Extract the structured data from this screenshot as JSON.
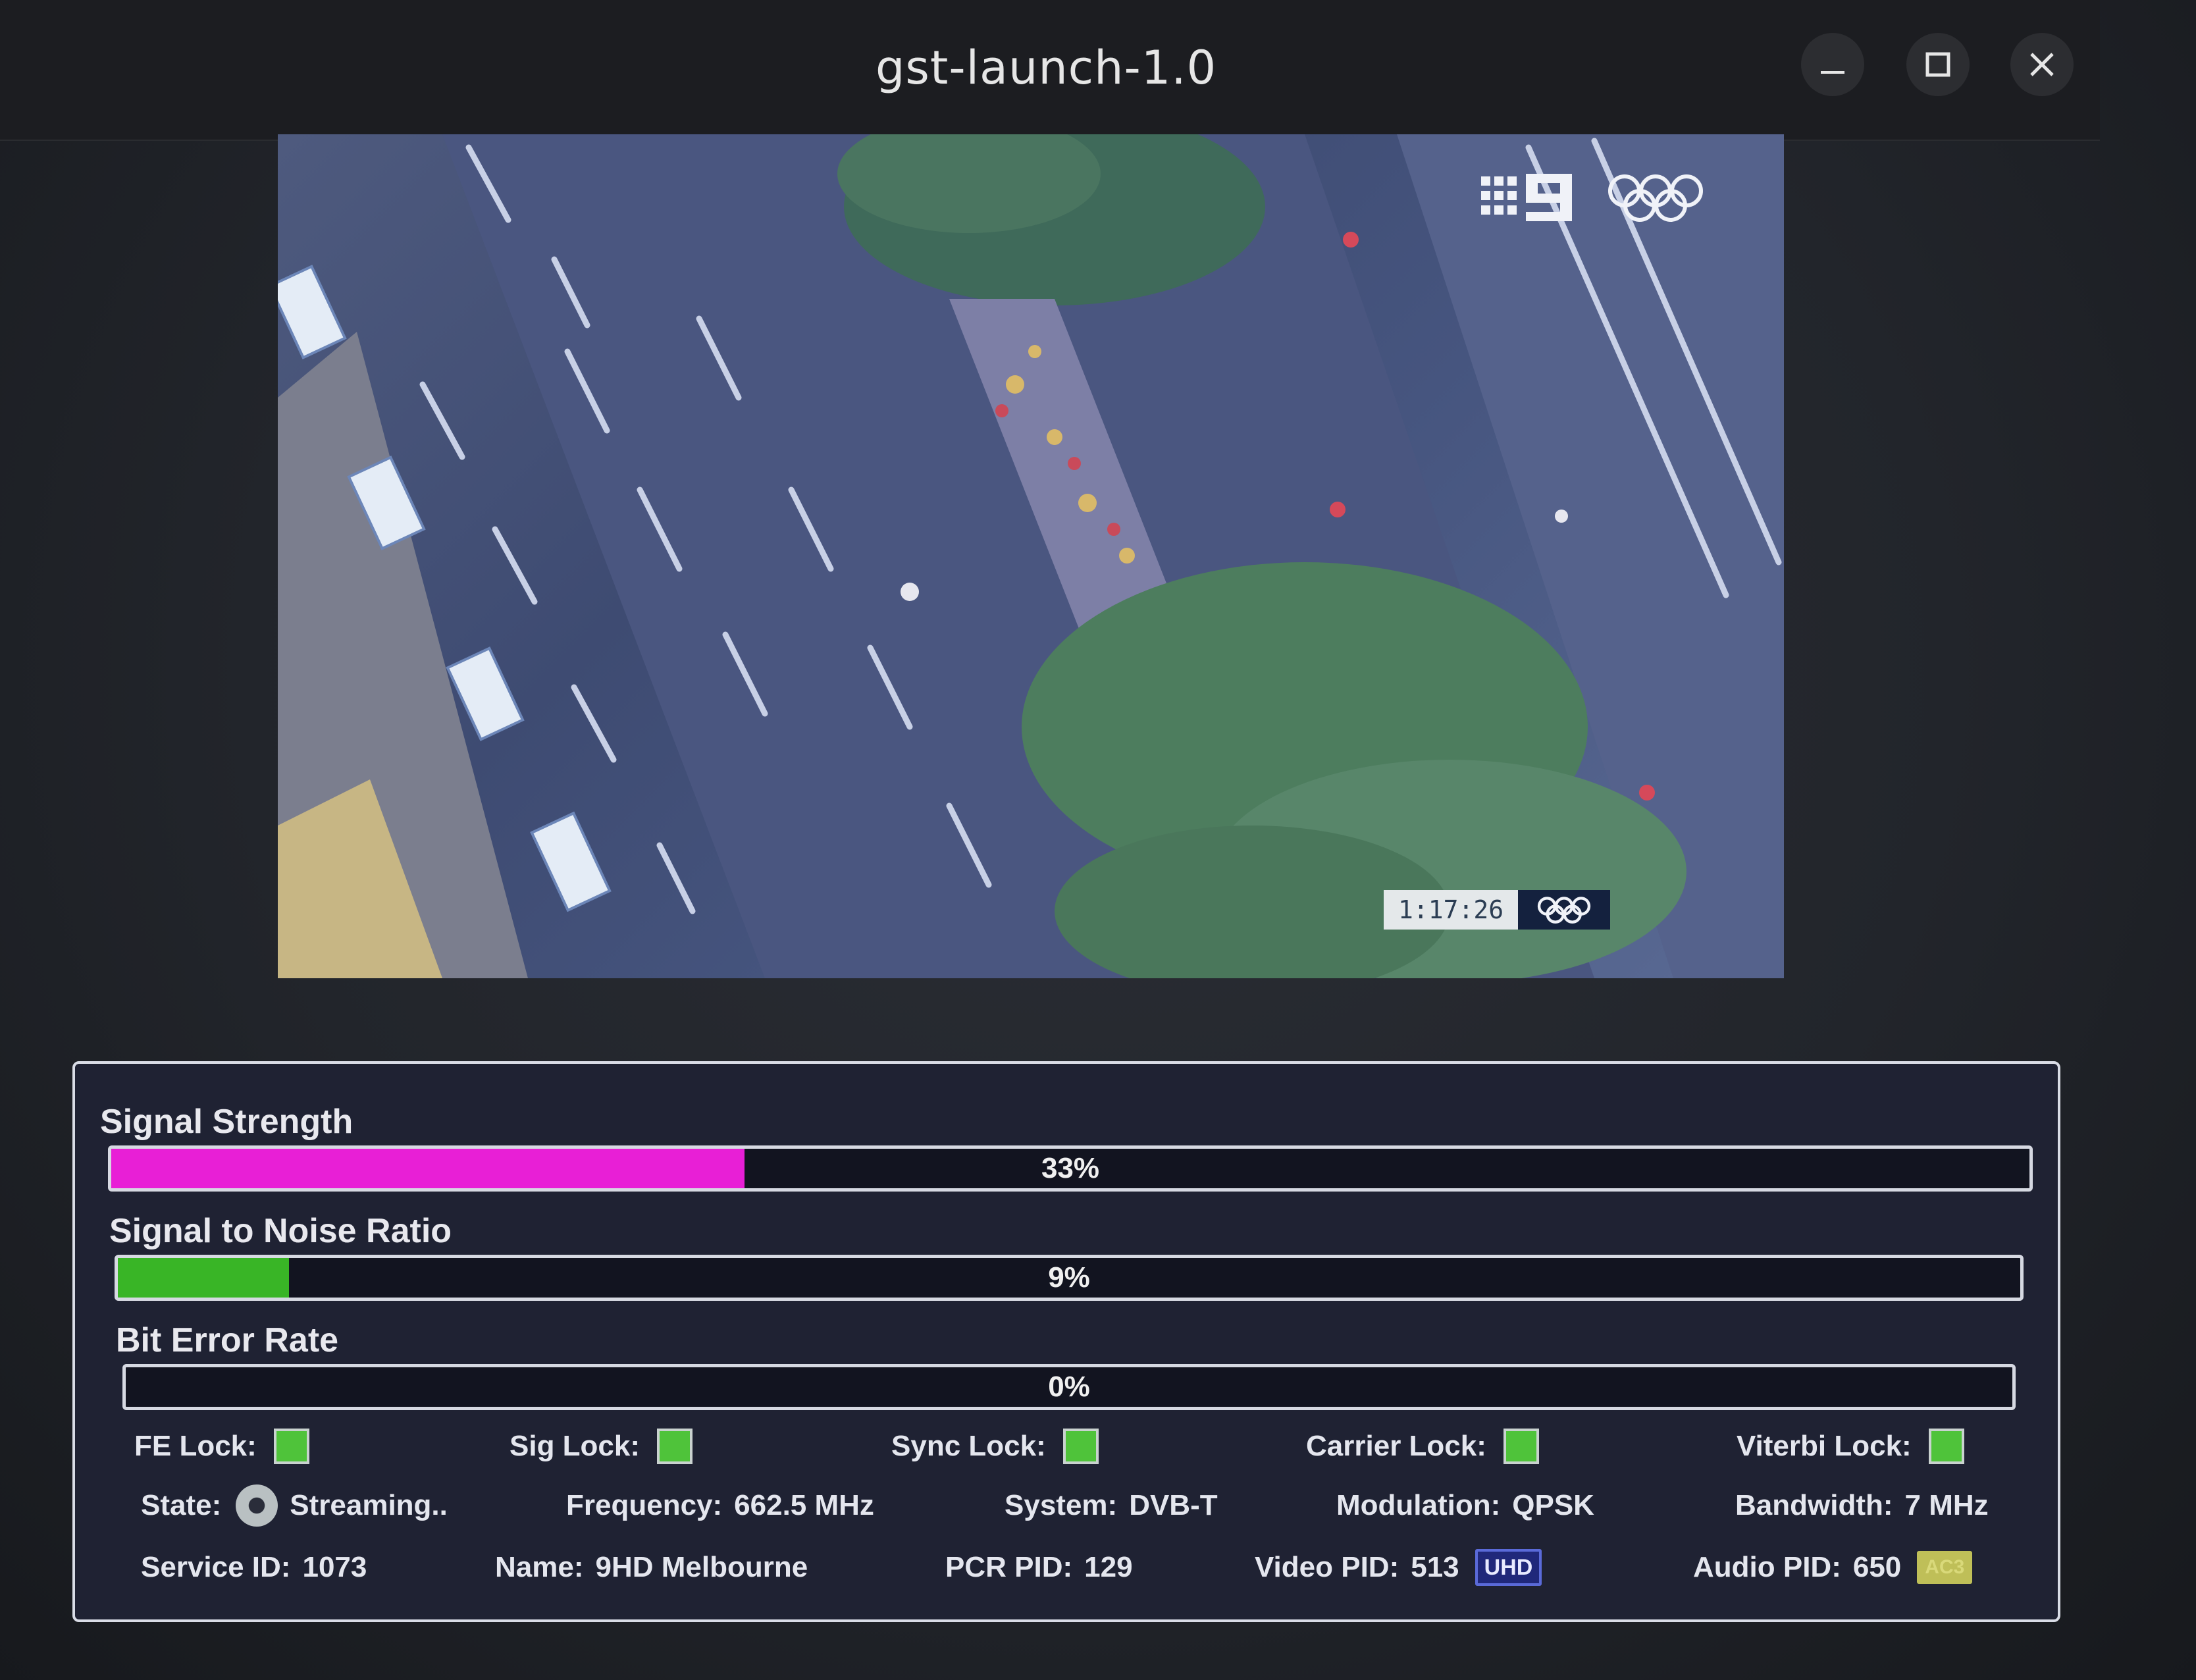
{
  "window": {
    "title": "gst-launch-1.0",
    "buttons": {
      "minimize_icon": "minimize-icon",
      "maximize_icon": "maximize-icon",
      "close_icon": "close-icon"
    }
  },
  "video": {
    "overlay_time": "1:17:26",
    "channel_logo": "channel-9-logo",
    "olympic_logo": "olympic-rings-icon"
  },
  "meters": [
    {
      "label": "Signal Strength",
      "value_text": "33%",
      "fraction": 0.33,
      "color": "#e81fd6"
    },
    {
      "label": "Signal to Noise Ratio",
      "value_text": "9%",
      "fraction": 0.09,
      "color": "#39b526"
    },
    {
      "label": "Bit Error Rate",
      "value_text": "0%",
      "fraction": 0.0,
      "color": "#39b526"
    }
  ],
  "locks": [
    {
      "label": "FE Lock:",
      "on": true
    },
    {
      "label": "Sig Lock:",
      "on": true
    },
    {
      "label": "Sync Lock:",
      "on": true
    },
    {
      "label": "Carrier Lock:",
      "on": true
    },
    {
      "label": "Viterbi Lock:",
      "on": true
    }
  ],
  "tuning": {
    "state_label": "State:",
    "state_value": "Streaming..",
    "frequency_label": "Frequency:",
    "frequency_value": "662.5 MHz",
    "system_label": "System:",
    "system_value": "DVB-T",
    "modulation_label": "Modulation:",
    "modulation_value": "QPSK",
    "bandwidth_label": "Bandwidth:",
    "bandwidth_value": "7 MHz"
  },
  "service": {
    "service_id_label": "Service ID:",
    "service_id_value": "1073",
    "name_label": "Name:",
    "name_value": "9HD Melbourne",
    "pcr_pid_label": "PCR PID:",
    "pcr_pid_value": "129",
    "video_pid_label": "Video PID:",
    "video_pid_value": "513",
    "video_badge": "UHD",
    "audio_pid_label": "Audio PID:",
    "audio_pid_value": "650",
    "audio_badge": "AC3"
  },
  "colors": {
    "lock_on": "#4fc33a",
    "panel_bg": "#1f2233",
    "signal_fill": "#e81fd6",
    "snr_fill": "#39b526"
  }
}
